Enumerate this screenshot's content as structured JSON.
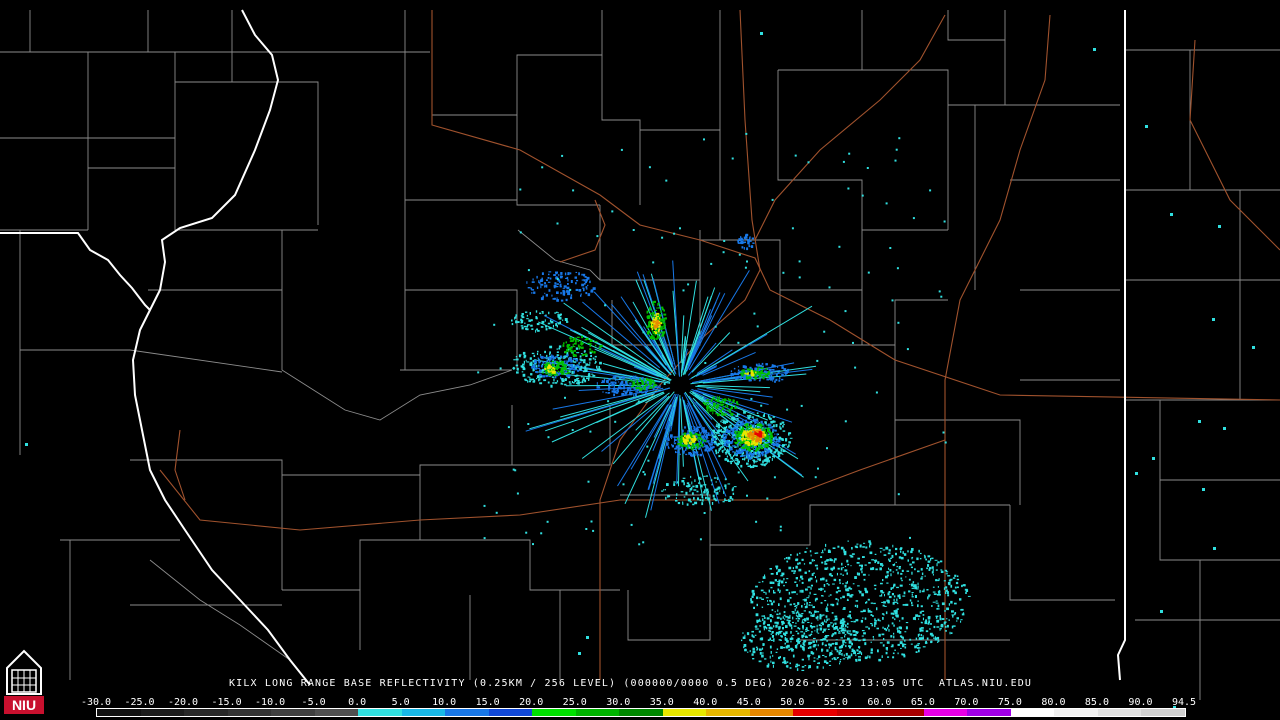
{
  "caption": "KILX LONG RANGE BASE REFLECTIVITY (0.25KM / 256 LEVEL) (000000/0000 0.5 DEG) 2026-02-23 13:05 UTC  ATLAS.NIU.EDU",
  "colorbar": {
    "labels": [
      "-30.0",
      "-25.0",
      "-20.0",
      "-15.0",
      "-10.0",
      "-5.0",
      "0.0",
      "5.0",
      "10.0",
      "15.0",
      "20.0",
      "25.0",
      "30.0",
      "35.0",
      "40.0",
      "45.0",
      "50.0",
      "55.0",
      "60.0",
      "65.0",
      "70.0",
      "75.0",
      "80.0",
      "85.0",
      "90.0",
      "94.5"
    ],
    "colors": [
      "#111111",
      "#1c1c1c",
      "#282828",
      "#333333",
      "#3f3f3f",
      "#4f4f4f",
      "#30e0e0",
      "#18b8e8",
      "#1878e8",
      "#1048d8",
      "#00e000",
      "#00b400",
      "#008800",
      "#e8e800",
      "#e8b800",
      "#e88800",
      "#e80000",
      "#c80000",
      "#a80000",
      "#e800e8",
      "#a000e8",
      "#ffffff",
      "#f0f0f0",
      "#e0e0e0",
      "#d0d0d0"
    ]
  },
  "logo": {
    "text": "NIU",
    "color": "#c8102e"
  },
  "map_colors": {
    "background": "#000000",
    "county_lines": "#8c8c8c",
    "state_lines": "#ffffff",
    "highways": "#a0522d"
  },
  "echo_colors": {
    "light": "#30e0e0",
    "blue": "#1878e8",
    "green": "#00c000",
    "yellow": "#e8e800",
    "orange": "#e88800",
    "red": "#e80000"
  }
}
